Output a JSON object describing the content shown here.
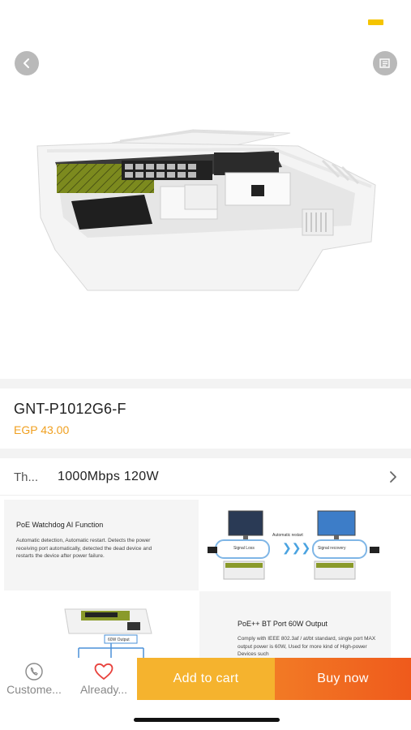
{
  "product": {
    "title": "GNT-P1012G6-F",
    "price": "EGP 43.00"
  },
  "variant": {
    "label": "Th...",
    "value": "1000Mbps 120W"
  },
  "detail": {
    "watchdog_title": "PoE Watchdog AI Function",
    "watchdog_text": "Automatic detection, Automatic restart. Detects the power receiving port automatically, detected the dead device and restarts the device after power failure.",
    "signal_loss": "Signal Loss",
    "auto_restart": "Automatic restart",
    "signal_recovery": "Signal recovery",
    "output_label": "60W Output",
    "bt_title": "PoE++ BT Port 60W Output",
    "bt_text": "Comply with IEEE 802.3af / at/bt standard, single port MAX output power is 60W, Used for more kind of High-power Devices such"
  },
  "bottom_bar": {
    "customer_label": "Custome...",
    "already_label": "Already...",
    "add_to_cart": "Add to cart",
    "buy_now": "Buy now"
  },
  "colors": {
    "accent": "#f0a020",
    "cart": "#f5b32e",
    "buy": "#ef5a1c",
    "favorite": "#e8413c"
  },
  "icons": [
    "back-icon",
    "share-icon",
    "chevron-right-icon",
    "phone-icon",
    "heart-icon"
  ]
}
